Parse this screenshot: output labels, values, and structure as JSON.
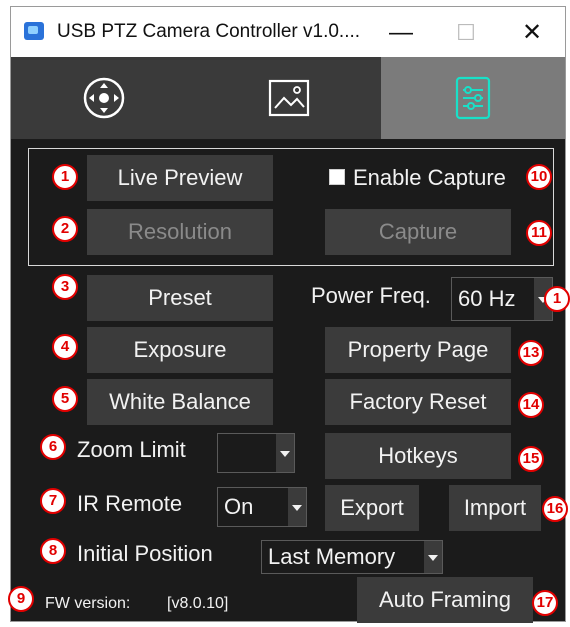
{
  "window": {
    "title": "USB PTZ Camera Controller v1.0....",
    "minimize_icon": "minimize-icon",
    "maximize_icon": "maximize-icon",
    "close_icon": "close-icon"
  },
  "tabs": [
    {
      "icon": "joystick-icon",
      "selected": false
    },
    {
      "icon": "image-icon",
      "selected": false
    },
    {
      "icon": "sliders-icon",
      "selected": true
    }
  ],
  "buttons": {
    "live_preview": "Live Preview",
    "resolution": "Resolution",
    "capture": "Capture",
    "preset": "Preset",
    "exposure": "Exposure",
    "white_balance": "White Balance",
    "property_page": "Property Page",
    "factory_reset": "Factory Reset",
    "hotkeys": "Hotkeys",
    "export": "Export",
    "import": "Import",
    "auto_framing": "Auto Framing"
  },
  "labels": {
    "enable_capture": "Enable Capture",
    "power_freq": "Power Freq.",
    "zoom_limit": "Zoom Limit",
    "ir_remote": "IR Remote",
    "initial_position": "Initial Position",
    "fw_version_label": "FW version:",
    "fw_version_value": "[v8.0.10]"
  },
  "selects": {
    "power_freq": "60 Hz",
    "zoom_limit": "",
    "ir_remote": "On",
    "initial_position": "Last Memory"
  },
  "enable_capture_checked": false,
  "badges": [
    "1",
    "2",
    "3",
    "4",
    "5",
    "6",
    "7",
    "8",
    "9",
    "10",
    "11",
    "1",
    "13",
    "14",
    "15",
    "16",
    "17"
  ],
  "colors": {
    "background": "#1b1b1b",
    "button": "#3b3b3b",
    "selected_tab": "#7b7b7b",
    "badge": "#e10000"
  }
}
